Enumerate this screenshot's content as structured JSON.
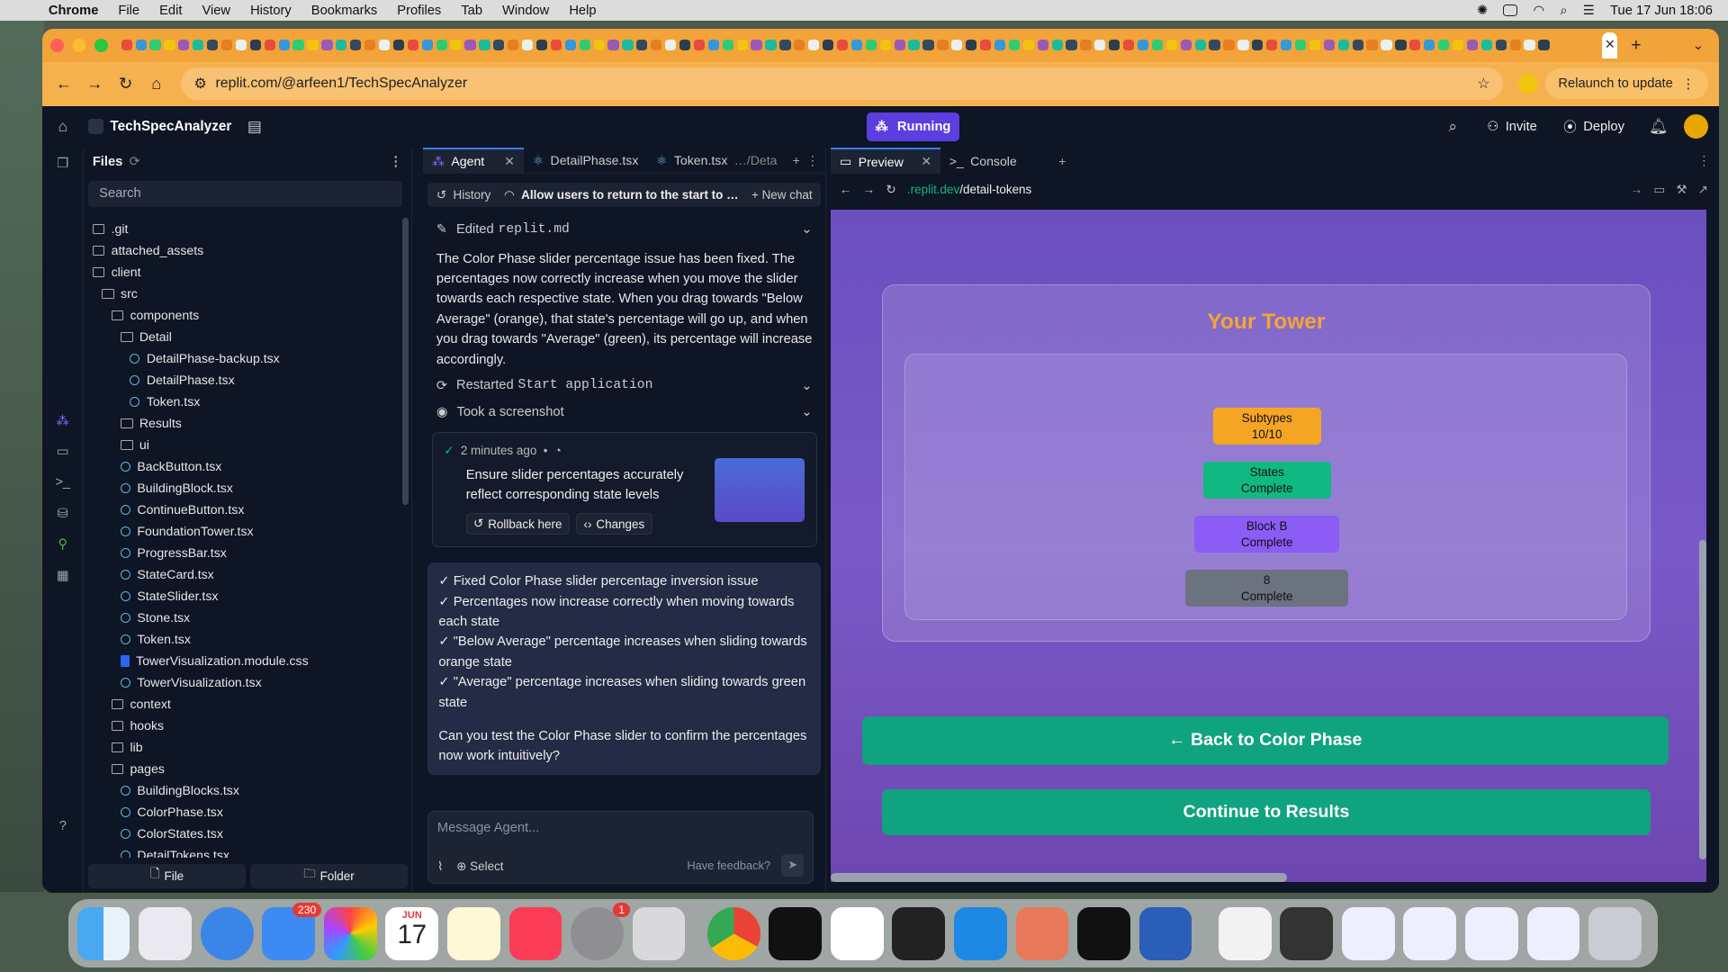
{
  "menubar": {
    "app": "Chrome",
    "items": [
      "File",
      "Edit",
      "View",
      "History",
      "Bookmarks",
      "Profiles",
      "Tab",
      "Window",
      "Help"
    ],
    "clock": "Tue 17 Jun  18:06"
  },
  "browser": {
    "url": "replit.com/@arfeen1/TechSpecAnalyzer",
    "relaunch_label": "Relaunch to update"
  },
  "workspace": {
    "project": "TechSpecAnalyzer",
    "status": "Running",
    "invite": "Invite",
    "deploy": "Deploy"
  },
  "files": {
    "title": "Files",
    "search_placeholder": "Search",
    "tree": [
      {
        "name": ".git",
        "type": "folder",
        "depth": 0
      },
      {
        "name": "attached_assets",
        "type": "folder",
        "depth": 0
      },
      {
        "name": "client",
        "type": "folder",
        "depth": 0
      },
      {
        "name": "src",
        "type": "folder",
        "depth": 1
      },
      {
        "name": "components",
        "type": "folder",
        "depth": 2
      },
      {
        "name": "Detail",
        "type": "folder",
        "depth": 3
      },
      {
        "name": "DetailPhase-backup.tsx",
        "type": "react",
        "depth": 4
      },
      {
        "name": "DetailPhase.tsx",
        "type": "react",
        "depth": 4
      },
      {
        "name": "Token.tsx",
        "type": "react",
        "depth": 4
      },
      {
        "name": "Results",
        "type": "folder",
        "depth": 3
      },
      {
        "name": "ui",
        "type": "folder",
        "depth": 3
      },
      {
        "name": "BackButton.tsx",
        "type": "react",
        "depth": 3
      },
      {
        "name": "BuildingBlock.tsx",
        "type": "react",
        "depth": 3
      },
      {
        "name": "ContinueButton.tsx",
        "type": "react",
        "depth": 3
      },
      {
        "name": "FoundationTower.tsx",
        "type": "react",
        "depth": 3
      },
      {
        "name": "ProgressBar.tsx",
        "type": "react",
        "depth": 3
      },
      {
        "name": "StateCard.tsx",
        "type": "react",
        "depth": 3
      },
      {
        "name": "StateSlider.tsx",
        "type": "react",
        "depth": 3
      },
      {
        "name": "Stone.tsx",
        "type": "react",
        "depth": 3
      },
      {
        "name": "Token.tsx",
        "type": "react",
        "depth": 3
      },
      {
        "name": "TowerVisualization.module.css",
        "type": "css",
        "depth": 3
      },
      {
        "name": "TowerVisualization.tsx",
        "type": "react",
        "depth": 3
      },
      {
        "name": "context",
        "type": "folder",
        "depth": 2
      },
      {
        "name": "hooks",
        "type": "folder",
        "depth": 2
      },
      {
        "name": "lib",
        "type": "folder",
        "depth": 2
      },
      {
        "name": "pages",
        "type": "folder",
        "depth": 2
      },
      {
        "name": "BuildingBlocks.tsx",
        "type": "react",
        "depth": 3
      },
      {
        "name": "ColorPhase.tsx",
        "type": "react",
        "depth": 3
      },
      {
        "name": "ColorStates.tsx",
        "type": "react",
        "depth": 3
      },
      {
        "name": "DetailTokens.tsx",
        "type": "react",
        "depth": 3
      }
    ],
    "new_file": "File",
    "new_folder": "Folder"
  },
  "agent": {
    "tabs": [
      "Agent",
      "DetailPhase.tsx",
      "Token.tsx",
      "…/Deta"
    ],
    "history": "History",
    "thread": "Allow users to return to the start to reasse...",
    "new_chat": "New chat",
    "edited_label": "Edited",
    "edited_file": "replit.md",
    "message": "The Color Phase slider percentage issue has been fixed. The percentages now correctly increase when you move the slider towards each respective state. When you drag towards \"Below Average\" (orange), that state's percentage will go up, and when you drag towards \"Average\" (green), its percentage will increase accordingly.",
    "restarted_label": "Restarted",
    "restarted_cmd": "Start application",
    "screenshot": "Took a screenshot",
    "checkpoint_time": "2 minutes ago",
    "checkpoint_title": "Ensure slider percentages accurately reflect corresponding state levels",
    "rollback": "Rollback here",
    "changes": "Changes",
    "summary": [
      "✓ Fixed Color Phase slider percentage inversion issue",
      "✓ Percentages now increase correctly when moving towards each state",
      "✓ \"Below Average\" percentage increases when sliding towards orange state",
      "✓ \"Average\" percentage increases when sliding towards green state"
    ],
    "question": "Can you test the Color Phase slider to confirm the percentages now work intuitively?",
    "input_placeholder": "Message Agent...",
    "select": "Select",
    "feedback": "Have feedback?"
  },
  "preview": {
    "tabs": [
      "Preview",
      "Console"
    ],
    "url_host": ".replit.dev",
    "url_path": "/detail-tokens",
    "tower_title": "Your Tower",
    "blocks": [
      {
        "line1": "Subtypes",
        "line2": "10/10",
        "color": "#f5a524"
      },
      {
        "line1": "States",
        "line2": "Complete",
        "color": "#10b981"
      },
      {
        "line1": "Block B",
        "line2": "Complete",
        "color": "#8b5cf6"
      },
      {
        "line1": "8",
        "line2": "Complete",
        "color": "#6b7280"
      }
    ],
    "back_button": "← Back to Color Phase",
    "continue_button": "Continue to Results"
  },
  "dock": {
    "mail_badge": "230",
    "calendar_month": "JUN",
    "calendar_day": "17",
    "settings_badge": "1"
  }
}
